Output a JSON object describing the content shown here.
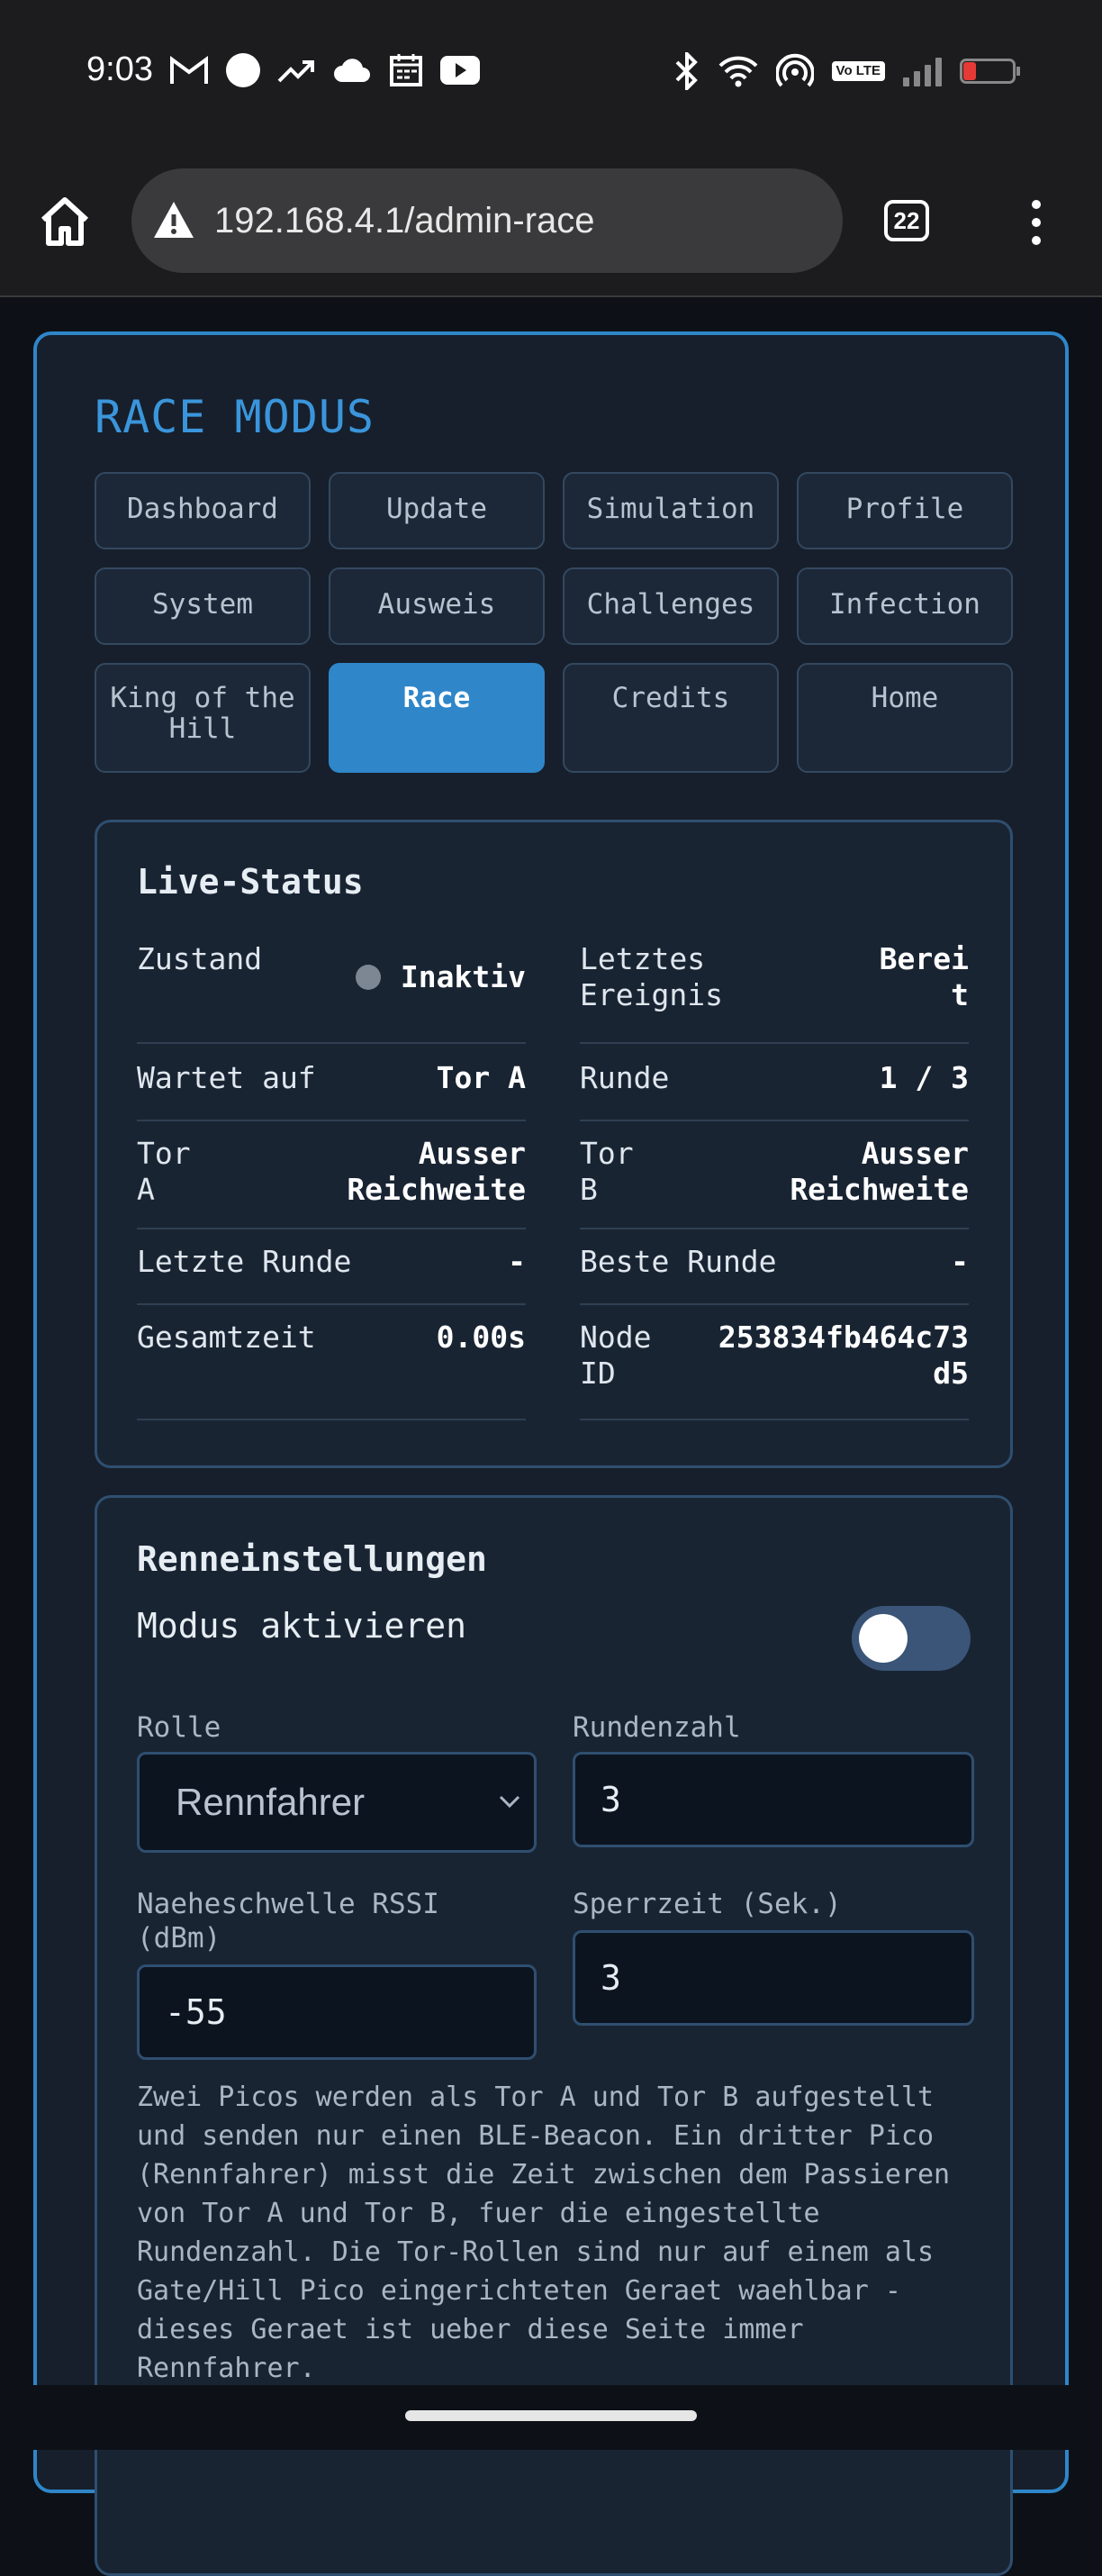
{
  "statusbar": {
    "time": "9:03",
    "left_icons": [
      "gmail-icon",
      "circle-icon",
      "trending-icon",
      "cloud-icon",
      "calendar-icon",
      "youtube-icon"
    ],
    "right_icons": [
      "bluetooth-icon",
      "wifi-icon",
      "hotspot-icon",
      "volte-icon",
      "signal-icon",
      "battery-icon"
    ],
    "volte_label": "Vo LTE"
  },
  "browser": {
    "url": "192.168.4.1/admin-race",
    "tab_count": "22"
  },
  "panel": {
    "title": "RACE MODUS",
    "nav": [
      {
        "label": "Dashboard"
      },
      {
        "label": "Update"
      },
      {
        "label": "Simulation"
      },
      {
        "label": "Profile"
      },
      {
        "label": "System"
      },
      {
        "label": "Ausweis"
      },
      {
        "label": "Challenges"
      },
      {
        "label": "Infection"
      },
      {
        "label": "King of the Hill"
      },
      {
        "label": "Race",
        "active": true
      },
      {
        "label": "Credits"
      },
      {
        "label": "Home"
      }
    ]
  },
  "live_status": {
    "title": "Live-Status",
    "left": [
      {
        "label": "Zustand",
        "value": "Inaktiv"
      },
      {
        "label": "Wartet auf",
        "value": "Tor A"
      },
      {
        "label": "Tor A",
        "value": "Ausser Reichweite"
      },
      {
        "label": "Letzte Runde",
        "value": "-"
      },
      {
        "label": "Gesamtzeit",
        "value": "0.00s"
      }
    ],
    "right": [
      {
        "label": "Letztes Ereignis",
        "value": "Bereit"
      },
      {
        "label": "Runde",
        "value": "1 / 3"
      },
      {
        "label": "Tor B",
        "value": "Ausser Reichweite"
      },
      {
        "label": "Beste Runde",
        "value": "-"
      },
      {
        "label": "Node ID",
        "value": "253834fb464c73d5"
      }
    ],
    "status_color": "#7d8793"
  },
  "settings": {
    "title": "Renneinstellungen",
    "toggle_label": "Modus aktivieren",
    "toggle_on": false,
    "role_label": "Rolle",
    "role_value": "Rennfahrer",
    "rounds_label": "Rundenzahl",
    "rounds_value": "3",
    "rssi_label": "Naeheschwelle RSSI (dBm)",
    "rssi_value": "-55",
    "lock_label": "Sperrzeit (Sek.)",
    "lock_value": "3",
    "help": "Zwei Picos werden als Tor A und Tor B aufgestellt und senden nur einen BLE-Beacon. Ein dritter Pico (Rennfahrer) misst die Zeit zwischen dem Passieren von Tor A und Tor B, fuer die eingestellte Rundenzahl. Die Tor-Rollen sind nur auf einem als Gate/Hill Pico eingerichteten Geraet waehlbar - dieses Geraet ist ueber diese Seite immer Rennfahrer."
  },
  "colors": {
    "accent": "#2f86c9",
    "panel_bg": "#161f2b",
    "card_bg": "#192433"
  }
}
